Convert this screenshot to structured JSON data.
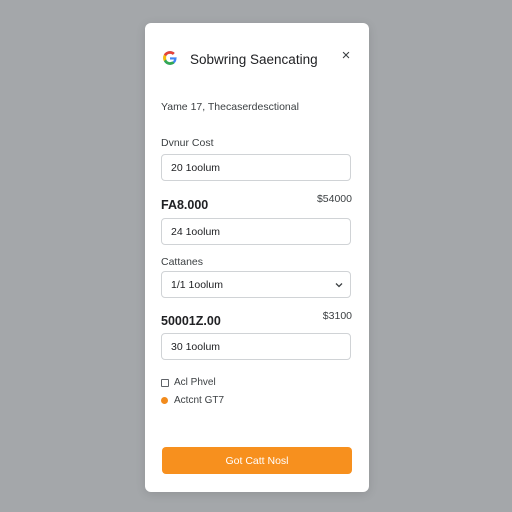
{
  "dialog": {
    "title": "Sobwring Saencating",
    "close_glyph": "×",
    "subtitle": "Yame 17, Thecaserdesctional"
  },
  "form": {
    "section1_label": "Dvnur Cost",
    "field1_value": "20 1oolum",
    "amount1_left": "FA8.000",
    "amount1_right": "$54000",
    "field2_value": "24 1oolum",
    "section2_label": "Cattanes",
    "select_value": "1/1 1oolum",
    "amount2_left": "50001Z.00",
    "amount2_right": "$3100",
    "field3_value": "30 1oolum"
  },
  "options": {
    "checkbox_label": "Acl Phvel",
    "radio_label": "Actcnt GT7"
  },
  "cta": {
    "label": "Got Catt Nosl"
  },
  "colors": {
    "accent": "#f7901e",
    "backdrop": "#a4a7aa",
    "logo_blue": "#4285f4",
    "logo_red": "#ea4335",
    "logo_yellow": "#fbbc05",
    "logo_green": "#34a853"
  },
  "icons": [
    "google-logo-icon",
    "close-icon",
    "chevron-down-icon",
    "checkbox-icon",
    "radio-dot-icon"
  ]
}
